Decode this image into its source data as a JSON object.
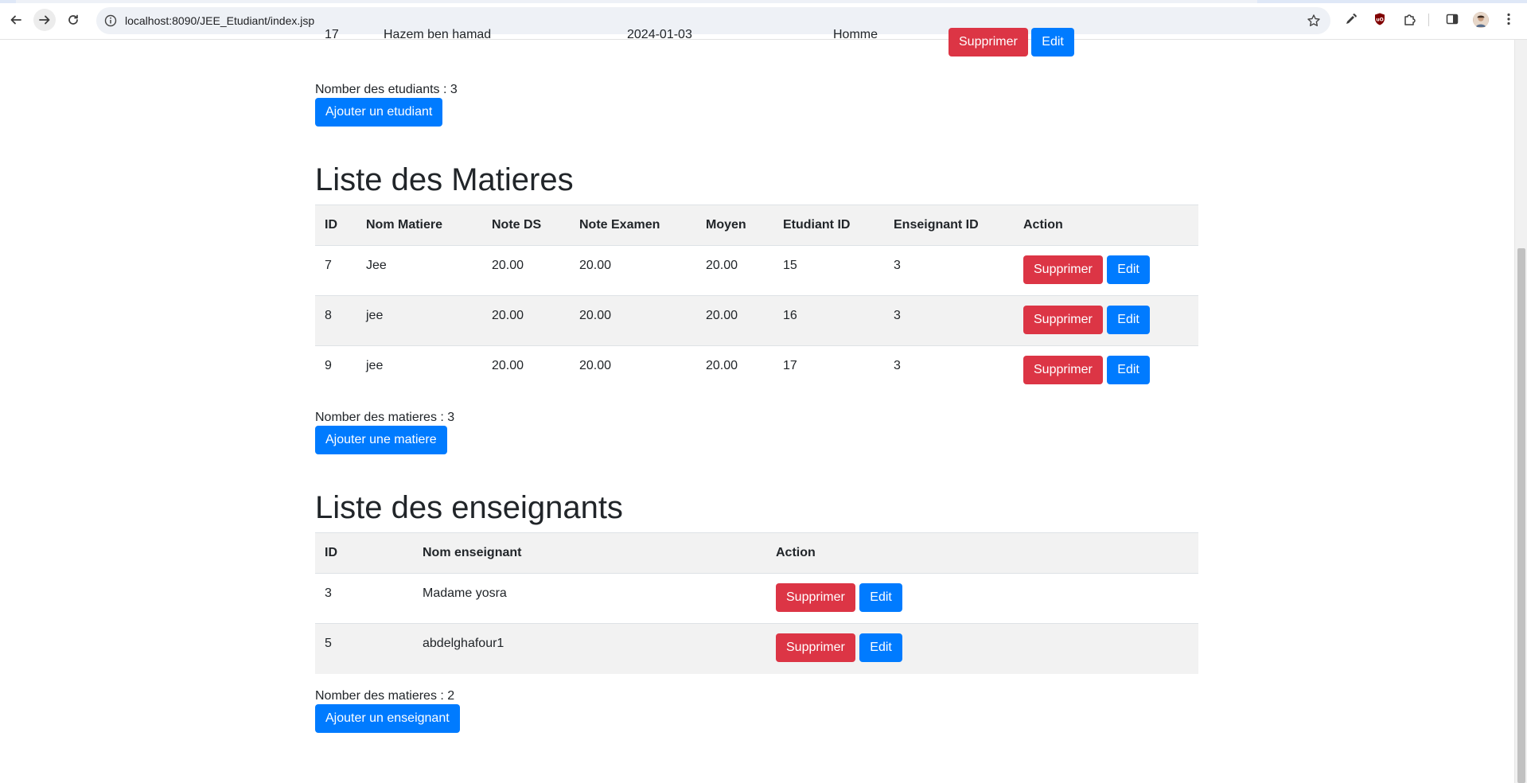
{
  "browser": {
    "url": "localhost:8090/JEE_Etudiant/index.jsp"
  },
  "etudiants": {
    "partial_row": {
      "id": "17",
      "nom": "Hazem ben hamad",
      "date": "2024-01-03",
      "genre": "Homme",
      "delete_label": "Supprimer",
      "edit_label": "Edit"
    },
    "count_text": "Nomber des etudiants : 3",
    "add_label": "Ajouter un etudiant"
  },
  "matieres": {
    "title": "Liste des Matieres",
    "headers": [
      "ID",
      "Nom Matiere",
      "Note DS",
      "Note Examen",
      "Moyen",
      "Etudiant ID",
      "Enseignant ID",
      "Action"
    ],
    "rows": [
      {
        "id": "7",
        "nom": "Jee",
        "note_ds": "20.00",
        "note_examen": "20.00",
        "moyen": "20.00",
        "etudiant_id": "15",
        "enseignant_id": "3"
      },
      {
        "id": "8",
        "nom": "jee",
        "note_ds": "20.00",
        "note_examen": "20.00",
        "moyen": "20.00",
        "etudiant_id": "16",
        "enseignant_id": "3"
      },
      {
        "id": "9",
        "nom": "jee",
        "note_ds": "20.00",
        "note_examen": "20.00",
        "moyen": "20.00",
        "etudiant_id": "17",
        "enseignant_id": "3"
      }
    ],
    "delete_label": "Supprimer",
    "edit_label": "Edit",
    "count_text": "Nomber des matieres : 3",
    "add_label": "Ajouter une matiere"
  },
  "enseignants": {
    "title": "Liste des enseignants",
    "headers": [
      "ID",
      "Nom enseignant",
      "Action"
    ],
    "rows": [
      {
        "id": "3",
        "nom": "Madame yosra"
      },
      {
        "id": "5",
        "nom": "abdelghafour1"
      }
    ],
    "delete_label": "Supprimer",
    "edit_label": "Edit",
    "count_text": "Nomber des matieres : 2",
    "add_label": "Ajouter un enseignant"
  },
  "colors": {
    "primary": "#007bff",
    "danger": "#dc3545",
    "stripe": "#f2f2f2"
  }
}
